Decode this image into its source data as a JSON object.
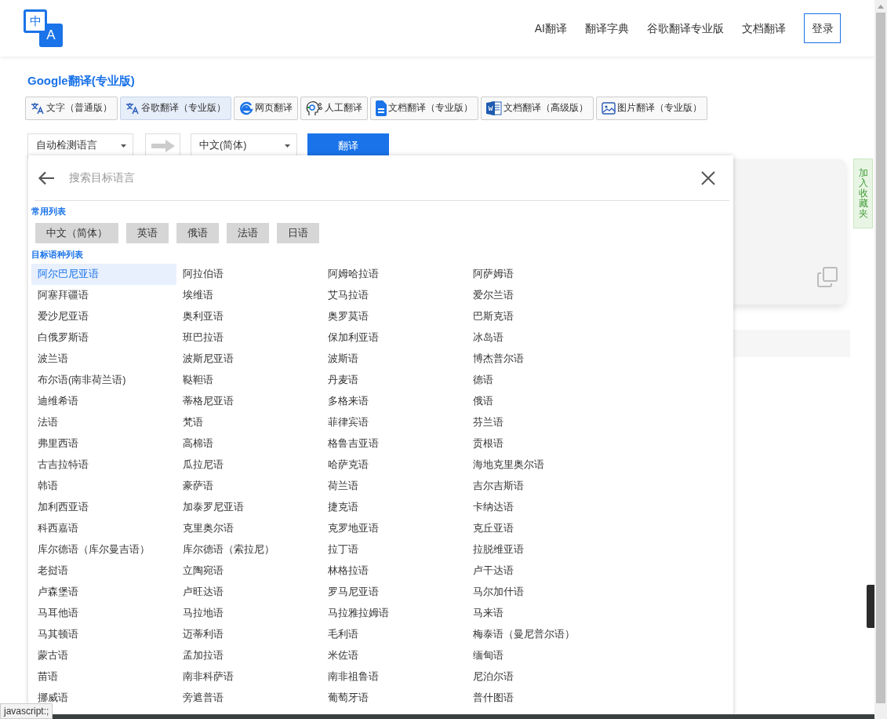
{
  "logo": {
    "top": "中",
    "bottom": "A"
  },
  "nav": [
    {
      "label": "AI翻译"
    },
    {
      "label": "翻译字典"
    },
    {
      "label": "谷歌翻译专业版"
    },
    {
      "label": "文档翻译"
    }
  ],
  "login": "登录",
  "page_title": "Google翻译(专业版)",
  "tools": [
    {
      "label": "文字（普通版）",
      "kind": "translate",
      "selected": false
    },
    {
      "label": "谷歌翻译（专业版）",
      "kind": "translate",
      "selected": true
    },
    {
      "label": "网页翻译",
      "kind": "web",
      "selected": false
    },
    {
      "label": "人工翻译",
      "kind": "person",
      "selected": false
    },
    {
      "label": "文档翻译（专业版）",
      "kind": "doc",
      "selected": false
    },
    {
      "label": "文档翻译（高级版）",
      "kind": "word",
      "selected": false
    },
    {
      "label": "图片翻译（专业版）",
      "kind": "image",
      "selected": false
    }
  ],
  "source_lang": "自动检测语言",
  "target_lang": "中文(简体)",
  "translate_button": "翻译",
  "picker": {
    "placeholder": "搜索目标语言",
    "common_heading": "常用列表",
    "common": [
      "中文（简体）",
      "英语",
      "俄语",
      "法语",
      "日语"
    ],
    "all_heading": "目标语种列表",
    "languages": [
      {
        "label": "阿尔巴尼亚语",
        "selected": true
      },
      {
        "label": "阿拉伯语",
        "selected": false
      },
      {
        "label": "阿姆哈拉语",
        "selected": false
      },
      {
        "label": "阿萨姆语",
        "selected": false
      },
      {
        "label": "阿塞拜疆语",
        "selected": false
      },
      {
        "label": "埃维语",
        "selected": false
      },
      {
        "label": "艾马拉语",
        "selected": false
      },
      {
        "label": "爱尔兰语",
        "selected": false
      },
      {
        "label": "爱沙尼亚语",
        "selected": false
      },
      {
        "label": "奥利亚语",
        "selected": false
      },
      {
        "label": "奥罗莫语",
        "selected": false
      },
      {
        "label": "巴斯克语",
        "selected": false
      },
      {
        "label": "白俄罗斯语",
        "selected": false
      },
      {
        "label": "班巴拉语",
        "selected": false
      },
      {
        "label": "保加利亚语",
        "selected": false
      },
      {
        "label": "冰岛语",
        "selected": false
      },
      {
        "label": "波兰语",
        "selected": false
      },
      {
        "label": "波斯尼亚语",
        "selected": false
      },
      {
        "label": "波斯语",
        "selected": false
      },
      {
        "label": "博杰普尔语",
        "selected": false
      },
      {
        "label": "布尔语(南非荷兰语)",
        "selected": false
      },
      {
        "label": "鞑靼语",
        "selected": false
      },
      {
        "label": "丹麦语",
        "selected": false
      },
      {
        "label": "德语",
        "selected": false
      },
      {
        "label": "迪维希语",
        "selected": false
      },
      {
        "label": "蒂格尼亚语",
        "selected": false
      },
      {
        "label": "多格来语",
        "selected": false
      },
      {
        "label": "俄语",
        "selected": false
      },
      {
        "label": "法语",
        "selected": false
      },
      {
        "label": "梵语",
        "selected": false
      },
      {
        "label": "菲律宾语",
        "selected": false
      },
      {
        "label": "芬兰语",
        "selected": false
      },
      {
        "label": "弗里西语",
        "selected": false
      },
      {
        "label": "高棉语",
        "selected": false
      },
      {
        "label": "格鲁吉亚语",
        "selected": false
      },
      {
        "label": "贡根语",
        "selected": false
      },
      {
        "label": "古吉拉特语",
        "selected": false
      },
      {
        "label": "瓜拉尼语",
        "selected": false
      },
      {
        "label": "哈萨克语",
        "selected": false
      },
      {
        "label": "海地克里奥尔语",
        "selected": false
      },
      {
        "label": "韩语",
        "selected": false
      },
      {
        "label": "豪萨语",
        "selected": false
      },
      {
        "label": "荷兰语",
        "selected": false
      },
      {
        "label": "吉尔吉斯语",
        "selected": false
      },
      {
        "label": "加利西亚语",
        "selected": false
      },
      {
        "label": "加泰罗尼亚语",
        "selected": false
      },
      {
        "label": "捷克语",
        "selected": false
      },
      {
        "label": "卡纳达语",
        "selected": false
      },
      {
        "label": "科西嘉语",
        "selected": false
      },
      {
        "label": "克里奥尔语",
        "selected": false
      },
      {
        "label": "克罗地亚语",
        "selected": false
      },
      {
        "label": "克丘亚语",
        "selected": false
      },
      {
        "label": "库尔德语（库尔曼吉语）",
        "selected": false
      },
      {
        "label": "库尔德语（索拉尼）",
        "selected": false
      },
      {
        "label": "拉丁语",
        "selected": false
      },
      {
        "label": "拉脱维亚语",
        "selected": false
      },
      {
        "label": "老挝语",
        "selected": false
      },
      {
        "label": "立陶宛语",
        "selected": false
      },
      {
        "label": "林格拉语",
        "selected": false
      },
      {
        "label": "卢干达语",
        "selected": false
      },
      {
        "label": "卢森堡语",
        "selected": false
      },
      {
        "label": "卢旺达语",
        "selected": false
      },
      {
        "label": "罗马尼亚语",
        "selected": false
      },
      {
        "label": "马尔加什语",
        "selected": false
      },
      {
        "label": "马耳他语",
        "selected": false
      },
      {
        "label": "马拉地语",
        "selected": false
      },
      {
        "label": "马拉雅拉姆语",
        "selected": false
      },
      {
        "label": "马来语",
        "selected": false
      },
      {
        "label": "马其顿语",
        "selected": false
      },
      {
        "label": "迈蒂利语",
        "selected": false
      },
      {
        "label": "毛利语",
        "selected": false
      },
      {
        "label": "梅泰语（曼尼普尔语）",
        "selected": false
      },
      {
        "label": "蒙古语",
        "selected": false
      },
      {
        "label": "孟加拉语",
        "selected": false
      },
      {
        "label": "米佐语",
        "selected": false
      },
      {
        "label": "缅甸语",
        "selected": false
      },
      {
        "label": "苗语",
        "selected": false
      },
      {
        "label": "南非科萨语",
        "selected": false
      },
      {
        "label": "南非祖鲁语",
        "selected": false
      },
      {
        "label": "尼泊尔语",
        "selected": false
      },
      {
        "label": "挪威语",
        "selected": false
      },
      {
        "label": "旁遮普语",
        "selected": false
      },
      {
        "label": "葡萄牙语",
        "selected": false
      },
      {
        "label": "普什图语",
        "selected": false
      }
    ]
  },
  "favorite_tab": "加入收藏夹",
  "status_text": "javascript:;"
}
